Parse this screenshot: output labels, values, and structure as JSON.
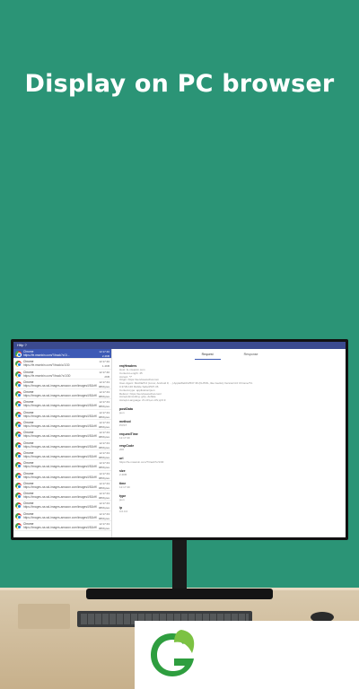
{
  "hero": {
    "title": "Display on PC browser"
  },
  "app": {
    "window_title": "Http ?",
    "tabs": [
      "Request",
      "Response"
    ],
    "requests": [
      {
        "app": "Chrome",
        "url": "https://fe.mweixin.com/?/track?c/1/...",
        "time": "12:17:40",
        "size": "2.4KB",
        "selected": true
      },
      {
        "app": "Chrome",
        "url": "https://fe.mweixin.com/?/track/c/1/30",
        "time": "12:17:40",
        "size": "1.4KB",
        "selected": false
      },
      {
        "app": "Chrome",
        "url": "https://fe.mweixin.com/?/track?c/1/30",
        "time": "12:17:40",
        "size": "2KB",
        "selected": false
      },
      {
        "app": "Chrome",
        "url": "https://images-na.ssl-images-amazon.com/images/I/81kHWTL...",
        "time": "12:17:43",
        "size": "989bytes",
        "selected": false
      },
      {
        "app": "Chrome",
        "url": "https://images-na.ssl-images-amazon.com/images/I/81kHWTL...",
        "time": "12:17:43",
        "size": "989bytes",
        "selected": false
      },
      {
        "app": "Chrome",
        "url": "https://images-na.ssl-images-amazon.com/images/I/81kHWTL...",
        "time": "12:17:43",
        "size": "989bytes",
        "selected": false
      },
      {
        "app": "Chrome",
        "url": "https://images-na.ssl-images-amazon.com/images/I/81kHWTL...",
        "time": "12:17:43",
        "size": "989bytes",
        "selected": false
      },
      {
        "app": "Chrome",
        "url": "https://images-na.ssl-images-amazon.com/images/I/81kHWTL...",
        "time": "12:17:43",
        "size": "989bytes",
        "selected": false
      },
      {
        "app": "Chrome",
        "url": "https://images-na.ssl-images-amazon.com/images/I/81kHWTL...",
        "time": "12:17:43",
        "size": "989bytes",
        "selected": false
      },
      {
        "app": "Chrome",
        "url": "https://images-na.ssl-images-amazon.com/images/I/81kHWTL...",
        "time": "12:17:43",
        "size": "989bytes",
        "selected": false
      },
      {
        "app": "Chrome",
        "url": "https://images-na.ssl-images-amazon.com/images/I/81kHWTL...",
        "time": "12:17:43",
        "size": "989bytes",
        "selected": false
      },
      {
        "app": "Chrome",
        "url": "https://images-na.ssl-images-amazon.com/images/I/81kHWTL...",
        "time": "12:17:43",
        "size": "989bytes",
        "selected": false
      },
      {
        "app": "Chrome",
        "url": "https://images-na.ssl-images-amazon.com/images/I/81kHWTL...",
        "time": "12:17:43",
        "size": "989bytes",
        "selected": false
      },
      {
        "app": "Chrome",
        "url": "https://images-na.ssl-images-amazon.com/images/I/81kHWTL...",
        "time": "12:17:43",
        "size": "989bytes",
        "selected": false
      },
      {
        "app": "Chrome",
        "url": "https://images-na.ssl-images-amazon.com/images/I/81kHWTL...",
        "time": "12:17:43",
        "size": "989bytes",
        "selected": false
      },
      {
        "app": "Chrome",
        "url": "https://images-na.ssl-images-amazon.com/images/I/81kHWTL...",
        "time": "12:17:43",
        "size": "989bytes",
        "selected": false
      },
      {
        "app": "Chrome",
        "url": "https://images-na.ssl-images-amazon.com/images/I/81kHWTL...",
        "time": "12:17:43",
        "size": "989bytes",
        "selected": false
      },
      {
        "app": "Chrome",
        "url": "https://images-na.ssl-images-amazon.com/images/I/81kHWTL...",
        "time": "12:17:43",
        "size": "989bytes",
        "selected": false
      }
    ],
    "details": [
      {
        "key": "reqHeaders",
        "value": "Host: fe.mweixin.com\nContent-Length: 45\nAccept: */*\nOrigin: https://servicewechat.com\nUser-Agent: Mozilla/5.0 (Linux; Android 9; ...) AppleWebKit/537.36 (KHTML, like Gecko) Version/4.0 Chrome/74.0.3729.136 Mobile Safari/537.36\nContent-type: application/json\nReferer: https://servicewechat.com/\nAccept-Encoding: gzip, deflate\nAccept-Language: zh-CN,en-US;q=0.9"
      },
      {
        "key": "postData",
        "value": "json"
      },
      {
        "key": "method",
        "value": "POST"
      },
      {
        "key": "requestTime",
        "value": "12:17:40"
      },
      {
        "key": "respCode",
        "value": "200"
      },
      {
        "key": "url",
        "value": "https://fe.mweixin.com/?/track?c/1/30"
      },
      {
        "key": "size",
        "value": "2.4KB"
      },
      {
        "key": "time",
        "value": "12:17:40"
      },
      {
        "key": "type",
        "value": "json"
      },
      {
        "key": "ip",
        "value": "0.0.0.0"
      }
    ]
  },
  "brand": {
    "logo_color": "#2e9e3f",
    "icon": "leaf-logo-icon"
  }
}
